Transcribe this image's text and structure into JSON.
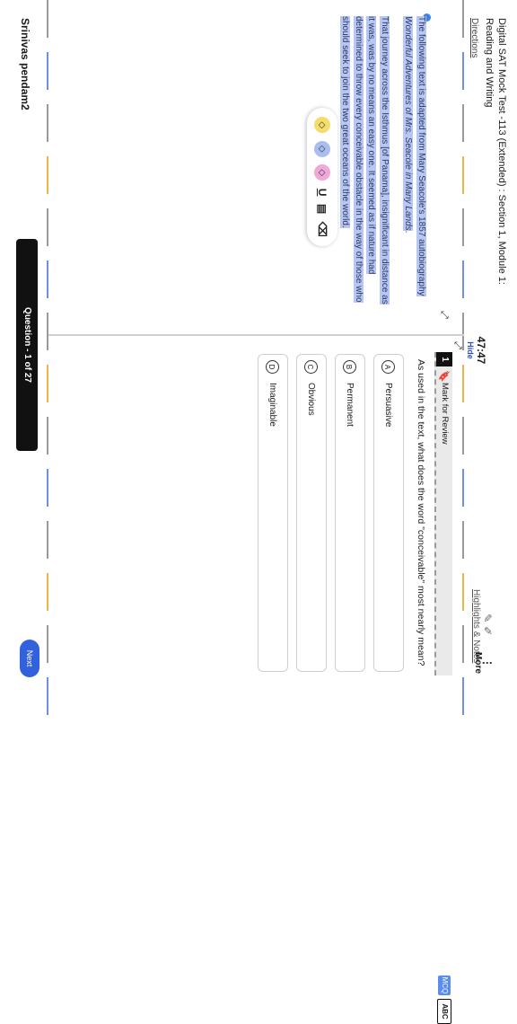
{
  "header": {
    "title_line1": "Digital SAT Mock Test -113 (Extended) : Section 1, Module 1:",
    "title_line2": "Reading and Writing",
    "directions": "Directions",
    "timer": "47:47",
    "hide": "Hide",
    "highlights_notes": "Highlights & Notes",
    "more": "More"
  },
  "passage": {
    "intro_a": "The following text is adapted from Mary Seacole's 1857 autobiography ",
    "intro_title": "Wonderful Adventures of Mrs. Seacole in Many Lands",
    "intro_end": ".",
    "body": "That journey across the Isthmus [of Panama], insignificant in distance as it was, was by no means an easy one. It seemed as if nature had determined to throw every conceivable obstacle in the way of those who should seek to join the two great oceans of the world."
  },
  "toolbar": {
    "colors": [
      "#f5dd6b",
      "#a9bdf0",
      "#f0a8d8"
    ]
  },
  "question": {
    "number": "1",
    "mark_for_review": "Mark for Review",
    "mcq": "MCQ",
    "abc": "ABC",
    "text": "As used in the text, what does the word \"conceivable\" most nearly mean?",
    "choices": [
      {
        "letter": "A",
        "text": "Persuasive"
      },
      {
        "letter": "B",
        "text": "Permanent"
      },
      {
        "letter": "C",
        "text": "Obvious"
      },
      {
        "letter": "D",
        "text": "Imaginable"
      }
    ]
  },
  "footer": {
    "user": "Srinivas pendam2",
    "question_nav": "Question - 1 of 27",
    "next": "Next"
  },
  "colors": {
    "highlight": "#b7c6f2",
    "accent": "#3161dc",
    "dash_blue": "#6f8fe8",
    "dash_orange": "#f2b24a"
  }
}
